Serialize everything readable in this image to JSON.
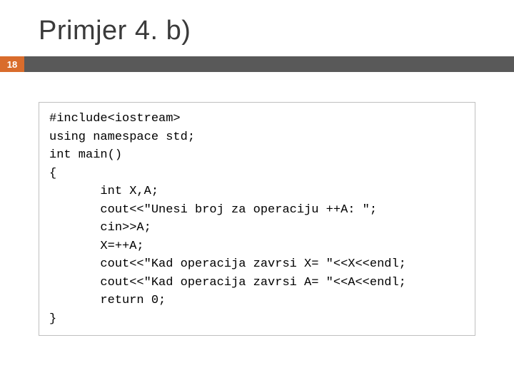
{
  "title": "Primjer 4. b)",
  "page_number": "18",
  "code": "#include<iostream>\nusing namespace std;\nint main()\n{\n       int X,A;\n       cout<<\"Unesi broj za operaciju ++A: \";\n       cin>>A;\n       X=++A;\n       cout<<\"Kad operacija zavrsi X= \"<<X<<endl;\n       cout<<\"Kad operacija zavrsi A= \"<<A<<endl;\n       return 0;\n}"
}
